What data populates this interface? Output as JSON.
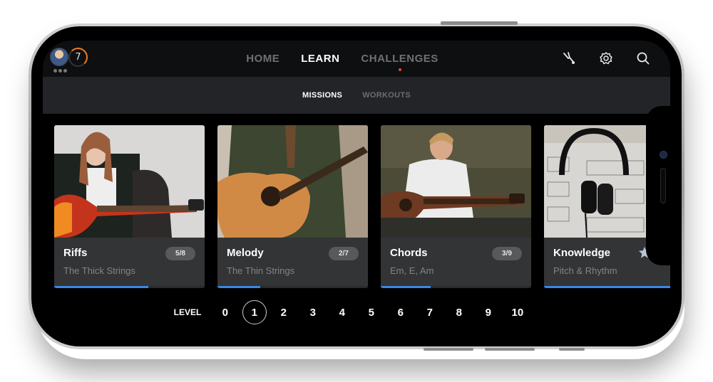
{
  "header": {
    "user_level": "7",
    "nav": [
      {
        "label": "HOME",
        "active": false
      },
      {
        "label": "LEARN",
        "active": true
      },
      {
        "label": "CHALLENGES",
        "active": false,
        "notification_dot": true
      }
    ],
    "icons": [
      "tuning-fork-icon",
      "gear-icon",
      "search-icon"
    ],
    "colors": {
      "accent_orange": "#f07d1a",
      "notification_red": "#e0452e"
    }
  },
  "subtabs": [
    {
      "label": "MISSIONS",
      "active": true
    },
    {
      "label": "WORKOUTS",
      "active": false
    }
  ],
  "cards": [
    {
      "title": "Riffs",
      "subtitle": "The Thick Strings",
      "badge": "5/8",
      "progress": 0.625,
      "image": "woman-electric-guitar-photo"
    },
    {
      "title": "Melody",
      "subtitle": "The Thin Strings",
      "badge": "2/7",
      "progress": 0.2857,
      "image": "man-acoustic-guitar-photo"
    },
    {
      "title": "Chords",
      "subtitle": "Em, E, Am",
      "badge": "3/9",
      "progress": 0.3333,
      "image": "man-seated-acoustic-guitar-photo"
    },
    {
      "title": "Knowledge",
      "subtitle": "Pitch & Rhythm",
      "badge_icon": "star-icon",
      "progress": 1.0,
      "image": "headphones-chord-sheets-photo"
    }
  ],
  "progress_color": "#3b87e6",
  "levels": {
    "label": "LEVEL",
    "values": [
      "0",
      "1",
      "2",
      "3",
      "4",
      "5",
      "6",
      "7",
      "8",
      "9",
      "10"
    ],
    "selected": "1"
  }
}
